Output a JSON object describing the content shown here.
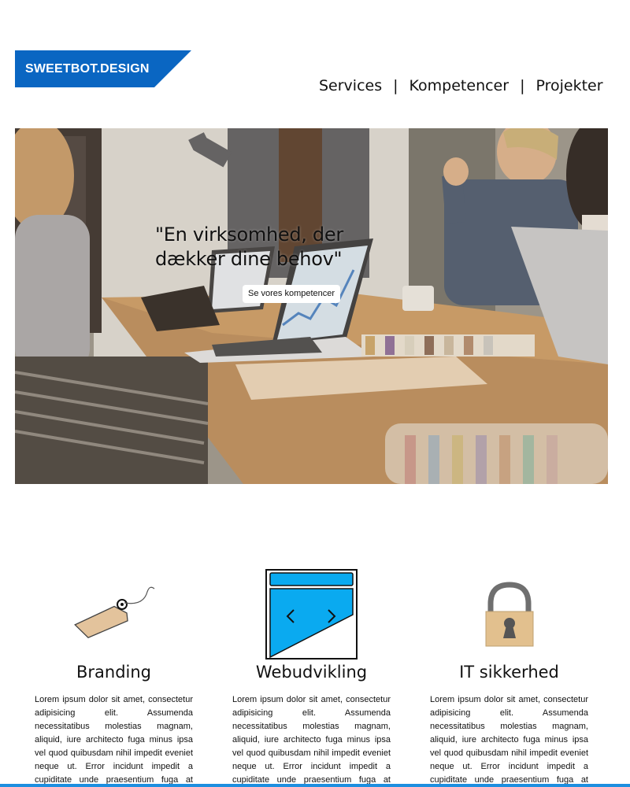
{
  "header": {
    "logo_text": "SWEETBOT.DESIGN",
    "nav": [
      {
        "label": "Services"
      },
      {
        "label": "Kompetencer"
      },
      {
        "label": "Projekter"
      }
    ],
    "separator": "|"
  },
  "hero": {
    "quote": "\"En virksomhed, der dækker dine behov\"",
    "button_label": "Se vores kompetencer"
  },
  "features": [
    {
      "title": "Branding",
      "icon": "price-tag-icon",
      "text": "Lorem ipsum dolor sit amet, consectetur adipisicing elit. Assumenda necessitatibus molestias magnam, aliquid, iure architecto fuga minus ipsa vel quod quibusdam nihil impedit eveniet neque ut. Error incidunt impedit a cupiditate unde praesentium fuga at saepe perspiciatis quo, ullam totam"
    },
    {
      "title": "Webudvikling",
      "icon": "browser-window-icon",
      "text": "Lorem ipsum dolor sit amet, consectetur adipisicing elit. Assumenda necessitatibus molestias magnam, aliquid, iure architecto fuga minus ipsa vel quod quibusdam nihil impedit eveniet neque ut. Error incidunt impedit a cupiditate unde praesentium fuga at saepe perspiciatis quo, ullam totam"
    },
    {
      "title": "IT sikkerhed",
      "icon": "padlock-icon",
      "text": "Lorem ipsum dolor sit amet, consectetur adipisicing elit. Assumenda necessitatibus molestias magnam, aliquid, iure architecto fuga minus ipsa vel quod quibusdam nihil impedit eveniet neque ut. Error incidunt impedit a cupiditate unde praesentium fuga at saepe perspiciatis quo, ullam totam"
    }
  ],
  "colors": {
    "brand_blue": "#0a66c2",
    "icon_blue": "#0aaaf0",
    "tag_tan": "#e3c39c",
    "lock_body": "#e2c08e",
    "lock_shackle": "#6f6f6f"
  }
}
